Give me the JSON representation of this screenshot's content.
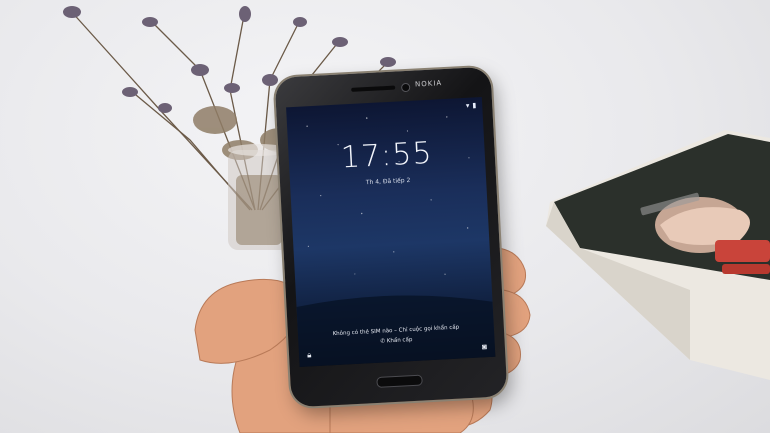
{
  "phone": {
    "brand": "NOKIA",
    "lockscreen": {
      "time": "17:55",
      "date": "Th 4, Đã tiếp 2",
      "sim_message": "Không có thẻ SIM nào – Chỉ cuộc gọi khẩn cấp",
      "emergency_label": "Khẩn cấp"
    }
  },
  "icons": {
    "lock": "lock-icon",
    "camera": "camera-icon",
    "wifi": "wifi-icon",
    "battery": "battery-icon",
    "phone": "phone-icon"
  },
  "colors": {
    "background": "#e9e9ec",
    "phone_body": "#1a1a1c",
    "phone_frame": "#8a8172",
    "screen_top": "#0d1633",
    "screen_mid": "#1d3766",
    "skin": "#e0a07e",
    "box_dark": "#2a2f2a",
    "box_red": "#c9443a"
  }
}
